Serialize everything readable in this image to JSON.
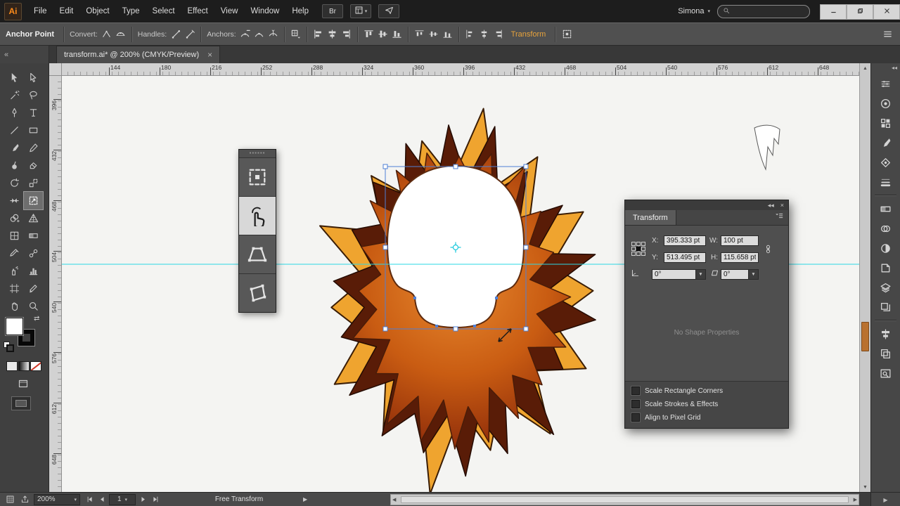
{
  "app": {
    "name": "Adobe Illustrator",
    "logo_text": "Ai"
  },
  "menu_bar": {
    "menus": [
      "File",
      "Edit",
      "Object",
      "Type",
      "Select",
      "Effect",
      "View",
      "Window",
      "Help"
    ],
    "bridge_label": "Br",
    "user_name": "Simona",
    "user_caret": "▾",
    "search_value": ""
  },
  "control_bar": {
    "context_label": "Anchor Point",
    "groups": [
      {
        "label": "Convert:",
        "icons": [
          "convert-corner",
          "convert-smooth"
        ]
      },
      {
        "label": "Handles:",
        "icons": [
          "handles-show",
          "handles-hide"
        ]
      },
      {
        "label": "Anchors:",
        "icons": [
          "anchor-delete",
          "anchor-connect",
          "anchor-cut"
        ]
      }
    ],
    "point_menu_icon": "anchor-point-menu",
    "align_groups": [
      [
        "align-left",
        "align-h-center",
        "align-right"
      ],
      [
        "align-top",
        "align-v-middle",
        "align-bottom"
      ],
      [
        "distribute-top",
        "distribute-v-center",
        "distribute-bottom"
      ],
      [
        "distribute-left",
        "distribute-h-center",
        "distribute-right"
      ]
    ],
    "transform_link": "Transform",
    "isolate_icon": "isolate-selection"
  },
  "tab_bar": {
    "collapse_icon": "«",
    "tab_title": "transform.ai* @ 200% (CMYK/Preview)",
    "close_label": "×"
  },
  "toolbar": {
    "tools": [
      "selection",
      "direct-selection",
      "magic-wand",
      "lasso",
      "pen",
      "type",
      "line-segment",
      "rectangle",
      "paintbrush",
      "pencil",
      "blob-brush",
      "eraser",
      "rotate",
      "scale",
      "width",
      "free-transform",
      "shape-builder",
      "perspective-grid",
      "mesh",
      "gradient",
      "eyedropper",
      "blend",
      "symbol-sprayer",
      "column-graph",
      "artboard",
      "slice",
      "hand",
      "zoom"
    ],
    "active_tool": "free-transform"
  },
  "rulers": {
    "horizontal_labels": [
      "144",
      "180",
      "216",
      "252",
      "288",
      "324",
      "360",
      "396",
      "432",
      "468",
      "504",
      "540",
      "576",
      "612",
      "648"
    ],
    "vertical_labels": [
      "396",
      "432",
      "468",
      "504",
      "540",
      "576",
      "612",
      "648"
    ]
  },
  "canvas": {
    "artwork": {
      "mane_gold": "#efa42f",
      "mane_gold_outline": "#3a1d06",
      "mane_dark": "#591c07",
      "mane_dark_outline": "#240b02",
      "mane_inner_center": "#e8892f",
      "mane_inner_mid": "#c95c12",
      "mane_inner_edge": "#8f2d0a",
      "mane_inner_outline": "#4a1c08",
      "skull_fill": "#ffffff",
      "skull_outline": "#5e2b0e",
      "claw_fill": "#ffffff",
      "claw_outline": "#5a5a5a",
      "selection_blue": "#4e7fd6",
      "handle_fill": "#ffffff",
      "guide_cyan": "#2bd8e4",
      "target_cyan": "#18c8dc",
      "cursor_black": "#1a1a1a"
    }
  },
  "free_transform_widget": {
    "buttons": [
      "constrain",
      "free-transform-touch",
      "perspective-distort",
      "free-distort"
    ],
    "active_index": 1
  },
  "transform_panel": {
    "collapse_icon": "◂◂",
    "close_icon": "×",
    "title": "Transform",
    "x_label": "X:",
    "x_value": "395.333 pt",
    "y_label": "Y:",
    "y_value": "513.495 pt",
    "w_label": "W:",
    "w_value": "100 pt",
    "h_label": "H:",
    "h_value": "115.658 pt",
    "rotate_value": "0°",
    "shear_value": "0°",
    "dropdown_caret": "▼",
    "empty_text": "No Shape Properties",
    "checkboxes": [
      "Scale Rectangle Corners",
      "Scale Strokes & Effects",
      "Align to Pixel Grid"
    ]
  },
  "right_dock": {
    "collapse_icon": "◂◂",
    "icons": [
      "color",
      "color-guide",
      "swatches",
      "brushes",
      "symbols",
      "stroke",
      "gradient",
      "transparency",
      "appearance",
      "graphic-styles",
      "layers",
      "artboards",
      "align",
      "pathfinder",
      "navigator"
    ]
  },
  "status_bar": {
    "zoom_value": "200%",
    "artboard_value": "1",
    "status_text": "Free Transform",
    "flyout_arrow": "▶"
  }
}
